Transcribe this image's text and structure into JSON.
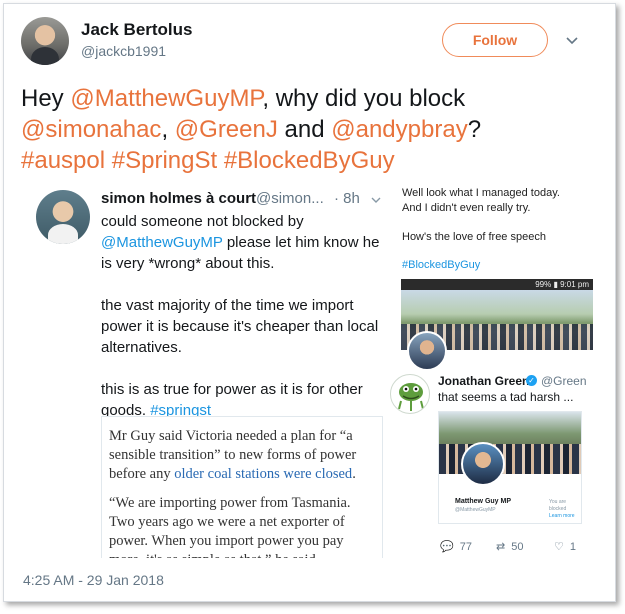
{
  "tweet": {
    "author_name": "Jack Bertolus",
    "author_handle": "@jackcb1991",
    "follow_label": "Follow",
    "text": {
      "t1": "Hey ",
      "m1": "@MatthewGuyMP",
      "t2": ", why did you block ",
      "m2": "@simonahac",
      "t3": ", ",
      "m3": "@GreenJ",
      "t4": " and ",
      "m4": "@andypbray",
      "t5": "?",
      "h1": "#auspol",
      "h2": "#SpringSt",
      "h3": "#BlockedByGuy"
    },
    "timestamp": "4:25 AM - 29 Jan 2018"
  },
  "quoted": {
    "name": "simon holmes à court",
    "handle": "@simon...",
    "time": "· 8h",
    "p1_a": "could someone not blocked by",
    "p1_mention": "@MatthewGuyMP",
    "p1_b": " please let him know he is very *wrong* about this.",
    "p2": "the vast majority of the time we import power it is because it's cheaper than local alternatives.",
    "p3_a": "this is as true for power as it is for other goods. ",
    "p3_tag": "#springst",
    "article": {
      "p1_a": "Mr Guy said Victoria needed a plan for “a sensible transition” to new forms of power before any ",
      "p1_link": "older coal stations were closed",
      "p1_b": ".",
      "p2": "“We are importing power from Tasmania. Two years ago we were a net exporter of power. When you import power you pay more, it's as simple as that,” he said."
    }
  },
  "screenshot": {
    "text1": "Well look what I managed today.",
    "text2": "And I didn't even really try.",
    "text3": "How's the love of free speech",
    "hashtag": "#BlockedByGuy",
    "status": "99% ▮ 9:01 pm",
    "reply": {
      "name": "Jonathan Green",
      "verified": "✓",
      "handle": "@Green",
      "text": "that seems a tad harsh ...",
      "card_name": "Matthew Guy MP",
      "card_handle": "@MatthewGuyMP",
      "card_right": "You are blocked",
      "card_right2": "Learn more"
    },
    "actions": {
      "replies": "77",
      "retweets": "50",
      "likes": "1"
    }
  }
}
